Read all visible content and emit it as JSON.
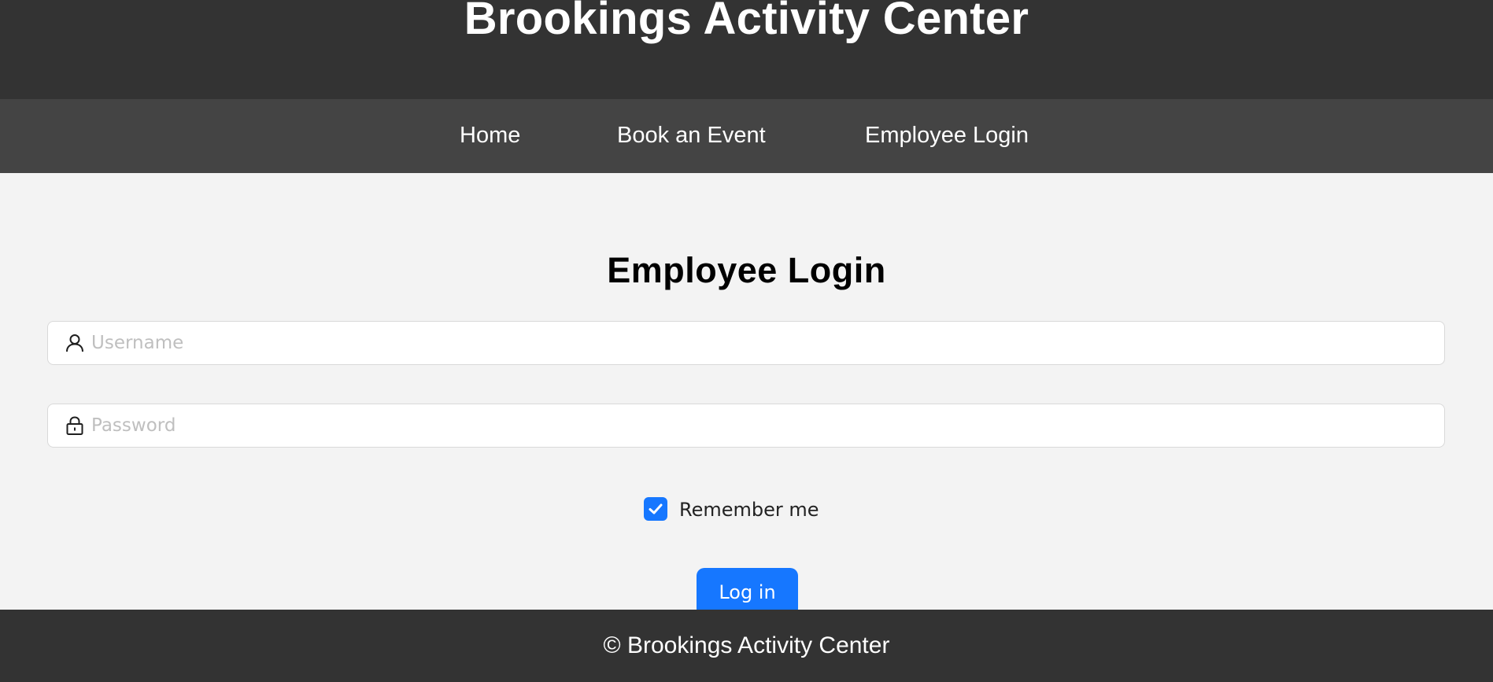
{
  "header": {
    "title": "Brookings Activity Center"
  },
  "nav": {
    "items": [
      {
        "label": "Home"
      },
      {
        "label": "Book an Event"
      },
      {
        "label": "Employee Login"
      }
    ]
  },
  "main": {
    "heading": "Employee Login",
    "username": {
      "value": "",
      "placeholder": "Username",
      "icon": "user-icon"
    },
    "password": {
      "value": "",
      "placeholder": "Password",
      "icon": "lock-icon"
    },
    "remember": {
      "label": "Remember me",
      "checked": true
    },
    "login_button": {
      "label": "Log in"
    }
  },
  "footer": {
    "text": "© Brookings Activity Center"
  },
  "colors": {
    "header_bg": "#333333",
    "nav_bg": "#444444",
    "page_bg": "#f3f3f3",
    "accent": "#1677ff"
  }
}
